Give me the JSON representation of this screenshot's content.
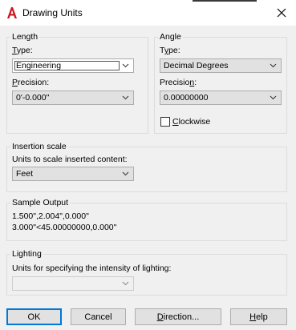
{
  "window": {
    "title": "Drawing Units"
  },
  "length": {
    "group_title": "Length",
    "type_label_u": "T",
    "type_label_rest": "ype:",
    "type_value": "Engineering",
    "precision_label_u": "P",
    "precision_label_rest": "recision:",
    "precision_value": "0'-0.000\""
  },
  "angle": {
    "group_title": "Angle",
    "type_label_a": "T",
    "type_label_u": "y",
    "type_label_rest": "pe:",
    "type_value": "Decimal Degrees",
    "precision_label_a": "Precisio",
    "precision_label_u": "n",
    "precision_label_rest": ":",
    "precision_value": "0.00000000",
    "clockwise_u": "C",
    "clockwise_rest": "lockwise",
    "clockwise_checked": false
  },
  "insertion": {
    "group_title": "Insertion scale",
    "units_label": "Units to scale inserted content:",
    "units_value": "Feet"
  },
  "sample": {
    "group_title": "Sample Output",
    "line1": "1.500\",2.004\",0.000\"",
    "line2": "3.000\"<45.00000000,0.000\""
  },
  "lighting": {
    "group_title": "Lighting",
    "units_label": "Units for specifying the intensity of lighting:",
    "units_value": ""
  },
  "buttons": {
    "ok": "OK",
    "cancel": "Cancel",
    "direction_u": "D",
    "direction_rest": "irection...",
    "help_u": "H",
    "help_rest": "elp"
  }
}
